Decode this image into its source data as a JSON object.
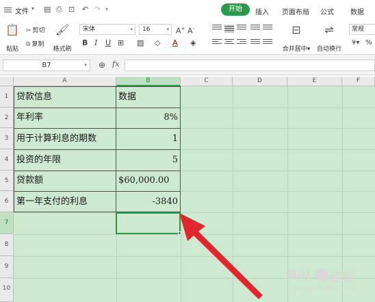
{
  "menu": {
    "file": "文件",
    "tabs": [
      "开始",
      "插入",
      "页面布局",
      "公式",
      "数据"
    ],
    "active_tab": "开始"
  },
  "ribbon": {
    "paste": "粘贴",
    "cut": "剪切",
    "copy": "复制",
    "format_painter": "格式刷",
    "font_name": "宋体",
    "font_size": "16",
    "merge_center": "合并居中",
    "wrap_text": "自动换行",
    "number_format": "常规"
  },
  "formula_bar": {
    "name_box": "B7",
    "fx": "fx",
    "formula": ""
  },
  "sheet": {
    "columns": [
      "A",
      "B",
      "C",
      "D",
      "E",
      "F"
    ],
    "rows": [
      "1",
      "2",
      "3",
      "4",
      "5",
      "6",
      "7",
      "8",
      "9",
      "10"
    ],
    "cells": [
      {
        "a": "贷款信息",
        "b": "数据"
      },
      {
        "a": "年利率",
        "b": "8%"
      },
      {
        "a": "用于计算利息的期数",
        "b": "1"
      },
      {
        "a": "投资的年限",
        "b": "5"
      },
      {
        "a": "贷款额",
        "b": "$60,000.00"
      },
      {
        "a": "第一年支付的利息",
        "b": "-3840"
      }
    ],
    "selected_cell": "B7"
  },
  "watermark": {
    "brand": "Bai",
    "brand_cn": "经验",
    "url": "jingyan.baidu.com"
  },
  "colors": {
    "accent": "#2a9a4a",
    "grid_fill": "#cde9d0",
    "arrow": "#e0262e"
  }
}
